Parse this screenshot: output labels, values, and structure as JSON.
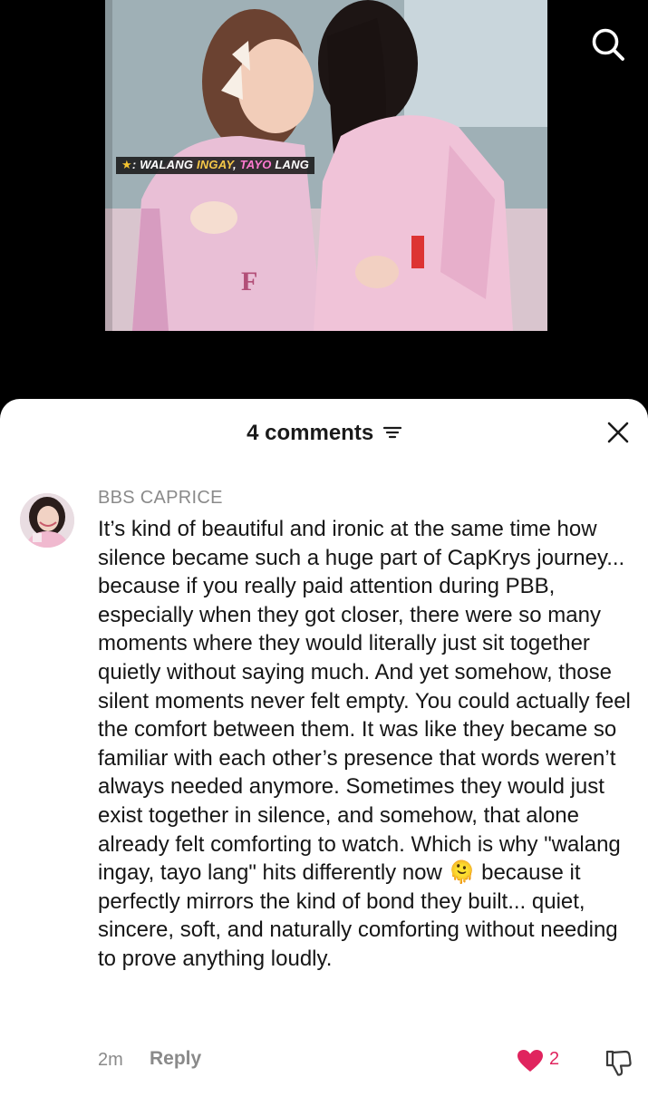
{
  "video": {
    "caption_star": "★",
    "caption_parts": [
      ": WALANG ",
      "INGAY",
      ", ",
      "TAYO",
      " LANG"
    ]
  },
  "header": {
    "comments_count": "4 comments"
  },
  "icons": {
    "search": "search-icon",
    "sort": "sort-icon",
    "close": "close-icon",
    "heart": "heart-icon",
    "dislike": "thumbs-down-icon",
    "emoji": "melting-face-emoji"
  },
  "colors": {
    "like_red": "#e0245e",
    "muted_gray": "#8a8a8a",
    "text_dark": "#161616"
  },
  "comment": {
    "username": "BBS CAPRICE",
    "text_before_emoji": "It’s kind of beautiful and ironic at the same time how silence became such a huge part of CapKrys journey... because if you really paid attention during PBB, especially when they got closer, there were so many moments where they would literally just sit together quietly without saying much. And yet somehow, those silent moments never felt empty. You could actually feel the comfort between them. It was like they became so familiar with each other’s presence that words weren’t always needed anymore. Sometimes they would just exist together in silence, and somehow, that alone already felt comforting to watch. Which is why \"walang ingay, tayo lang\" hits differently now",
    "emoji": "🫠",
    "text_after_emoji": "because it perfectly mirrors the kind of bond they built... quiet, sincere, soft, and naturally comforting without needing to prove anything loudly.",
    "time": "2m",
    "reply_label": "Reply",
    "like_count": "2",
    "liked": true
  }
}
